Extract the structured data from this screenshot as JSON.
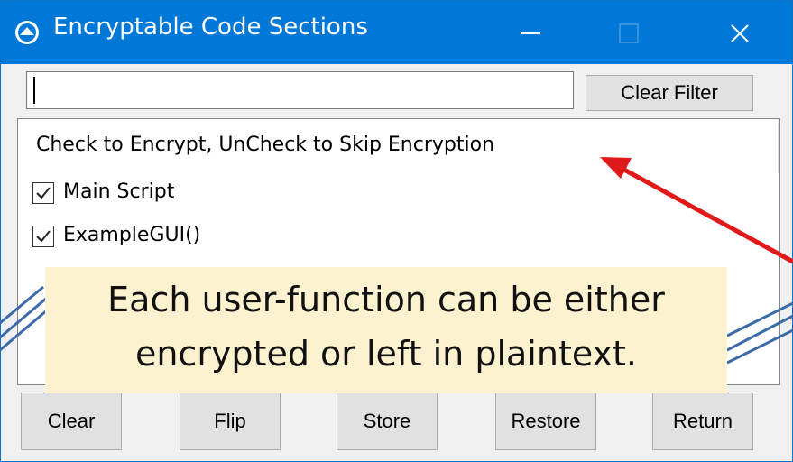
{
  "window": {
    "title": "Encryptable Code Sections",
    "title_bar_color": "#0078d7",
    "icons": [
      "app-icon",
      "minimize-icon",
      "maximize-icon",
      "close-icon"
    ]
  },
  "filter": {
    "value": "",
    "clear_label": "Clear Filter"
  },
  "list": {
    "header": "Check to Encrypt, UnCheck to Skip Encryption",
    "items": [
      {
        "label": "Main Script",
        "checked": true
      },
      {
        "label": "ExampleGUI()",
        "checked": true
      }
    ]
  },
  "buttons": {
    "clear": "Clear",
    "flip": "Flip",
    "store": "Store",
    "restore": "Restore",
    "return": "Return"
  },
  "annotation": {
    "line1": "Each user-function can be either",
    "line2": "encrypted or left in plaintext.",
    "background_color": "#fdf2d0",
    "arrow_color": "#e0191b",
    "connector_color": "#3d6aa8"
  }
}
